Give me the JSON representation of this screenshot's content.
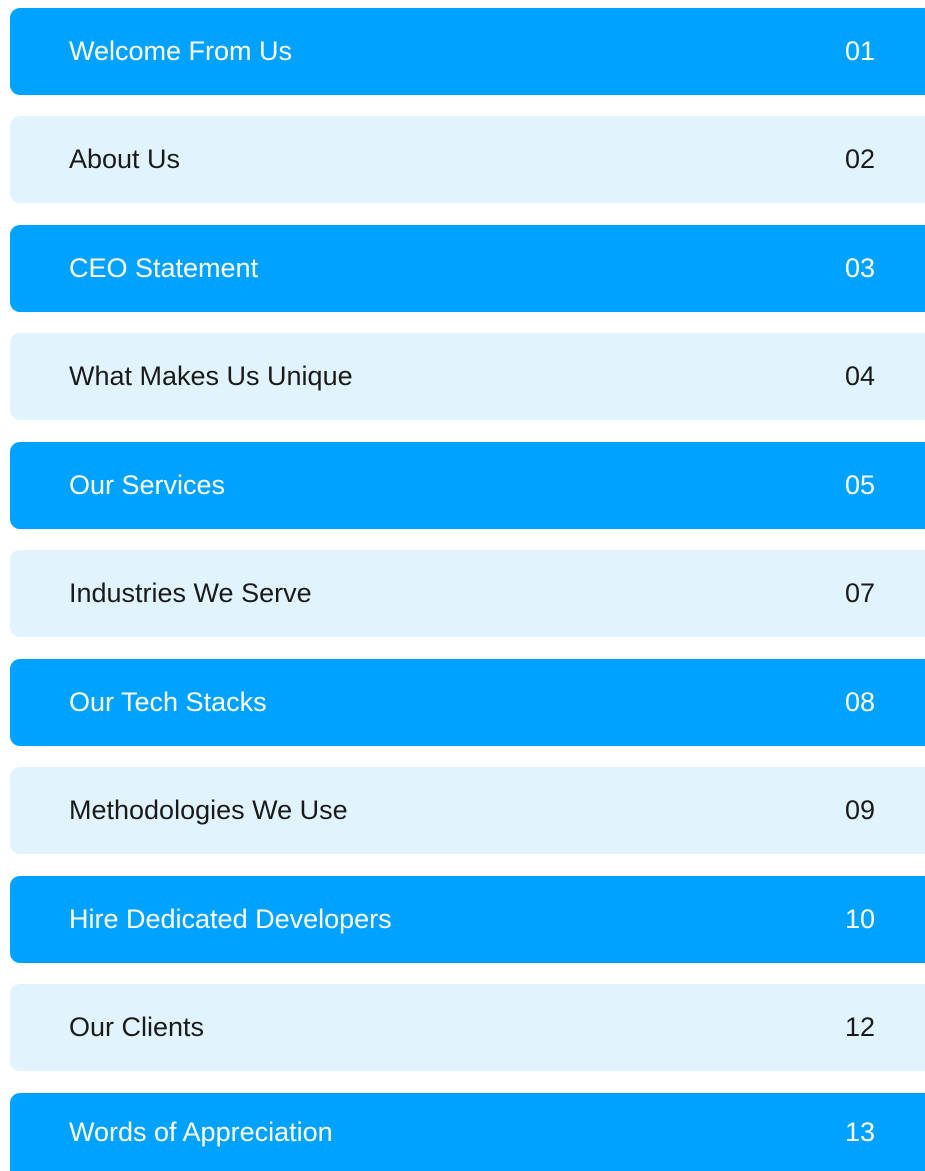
{
  "colors": {
    "accent_row": "#00a2ff",
    "light_row": "#e1f4fe",
    "accent_text": "#ffffff",
    "light_text": "#1a1a1a"
  },
  "toc": {
    "entries": [
      {
        "title": "Welcome From Us",
        "page": "01",
        "style": "accent"
      },
      {
        "title": "About Us",
        "page": "02",
        "style": "light"
      },
      {
        "title": "CEO Statement",
        "page": "03",
        "style": "accent"
      },
      {
        "title": "What Makes Us Unique",
        "page": "04",
        "style": "light"
      },
      {
        "title": "Our Services",
        "page": "05",
        "style": "accent"
      },
      {
        "title": "Industries We Serve",
        "page": "07",
        "style": "light"
      },
      {
        "title": "Our Tech Stacks",
        "page": "08",
        "style": "accent"
      },
      {
        "title": "Methodologies We Use",
        "page": "09",
        "style": "light"
      },
      {
        "title": "Hire Dedicated Developers",
        "page": "10",
        "style": "accent"
      },
      {
        "title": "Our Clients",
        "page": "12",
        "style": "light"
      },
      {
        "title": "Words of Appreciation",
        "page": "13",
        "style": "accent"
      }
    ]
  }
}
